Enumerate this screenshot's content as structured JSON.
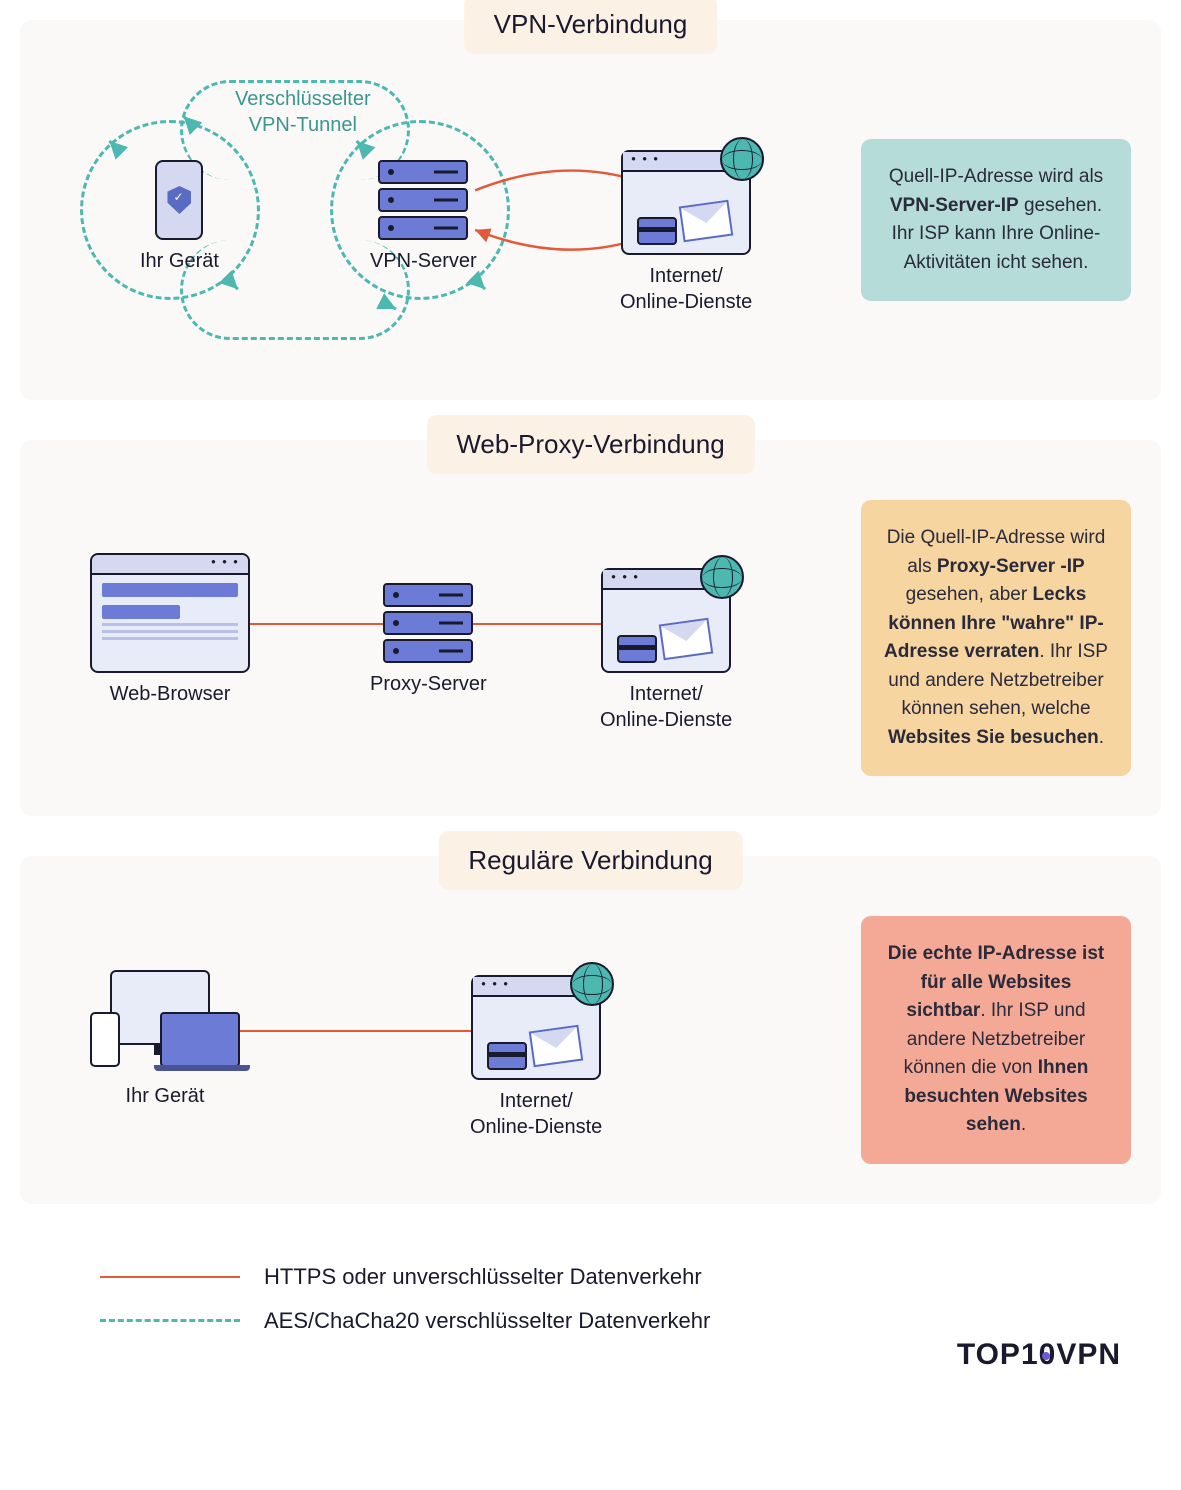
{
  "sections": {
    "vpn": {
      "title": "VPN-Verbindung",
      "tunnel_label_1": "Verschlüsselter",
      "tunnel_label_2": "VPN-Tunnel",
      "node1_label": "Ihr Gerät",
      "node2_label": "VPN-Server",
      "node3_label_1": "Internet/",
      "node3_label_2": "Online-Dienste",
      "info_pre": "Quell-IP-Adresse wird als ",
      "info_b1": "VPN-Server-IP",
      "info_post": " gesehen. Ihr ISP kann Ihre Online-Aktivitäten icht sehen."
    },
    "proxy": {
      "title": "Web-Proxy-Verbindung",
      "node1_label": "Web-Browser",
      "node2_label": "Proxy-Server",
      "node3_label_1": "Internet/",
      "node3_label_2": "Online-Dienste",
      "info_pre": "Die Quell-IP-Adresse wird als ",
      "info_b1": "Proxy-Server -IP",
      "info_mid1": " gesehen, aber ",
      "info_b2": "Lecks können Ihre \"wahre\" IP-Adresse verraten",
      "info_mid2": ". Ihr ISP und andere Netzbetreiber können sehen, welche ",
      "info_b3": "Websites Sie besuchen",
      "info_post": "."
    },
    "regular": {
      "title": "Reguläre Verbindung",
      "node1_label": "Ihr Gerät",
      "node3_label_1": "Internet/",
      "node3_label_2": "Online-Dienste",
      "info_b1": "Die echte IP-Adresse ist für alle Websites sichtbar",
      "info_mid": ". Ihr ISP und andere Netzbetreiber können die von ",
      "info_b2": "Ihnen besuchten Websites sehen",
      "info_post": "."
    }
  },
  "legend": {
    "solid": "HTTPS oder unverschlüsselter Datenverkehr",
    "dashed": "AES/ChaCha20 verschlüsselter Datenverkehr"
  },
  "logo": "TOP10VPN"
}
